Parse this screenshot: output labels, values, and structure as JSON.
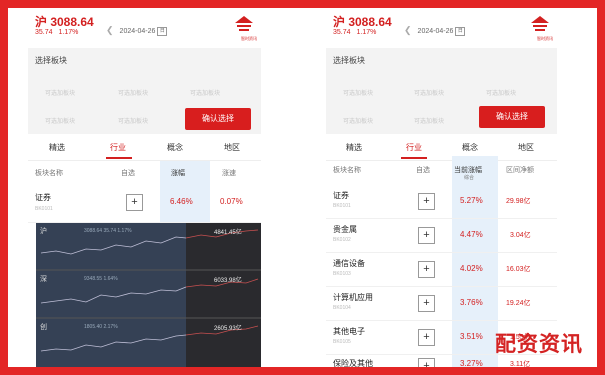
{
  "header": {
    "index_label": "沪 3088.64",
    "change": "35.74",
    "change_pct": "1.17%",
    "date": "2024-04-26",
    "calendar_glyph": "日",
    "logo_text": "智时资讯"
  },
  "selection": {
    "title": "选择板块",
    "options": [
      "可选加板块",
      "可选加板块",
      "可选加板块",
      "可选加板块",
      "可选加板块"
    ],
    "confirm_label": "确认选择"
  },
  "tabs": [
    "精选",
    "行业",
    "概念",
    "地区"
  ],
  "active_tab_index": 1,
  "left_table": {
    "columns": [
      "板块名称",
      "自选",
      "涨幅",
      "涨速"
    ],
    "rows": [
      {
        "name": "证券",
        "code": "BK0101",
        "pct": "6.46%",
        "speed": "0.07%"
      }
    ]
  },
  "charts": [
    {
      "label": "沪",
      "inner": "3088.64  35.74  1.17%",
      "value": "4841.45亿"
    },
    {
      "label": "深",
      "inner": "9348.55  1.64%",
      "value": "6033.98亿"
    },
    {
      "label": "创",
      "inner": "1805.40  2.17%",
      "value": "2605.93亿"
    }
  ],
  "right_table": {
    "columns": [
      "板块名称",
      "自选",
      "当前涨幅",
      "区间净额"
    ],
    "sort_label": "综合",
    "rows": [
      {
        "name": "证券",
        "code": "BK0101",
        "pct": "5.27%",
        "amount": "29.98亿"
      },
      {
        "name": "贵金属",
        "code": "BK0102",
        "pct": "4.47%",
        "amount": "3.04亿"
      },
      {
        "name": "通信设备",
        "code": "BK0103",
        "pct": "4.02%",
        "amount": "16.03亿"
      },
      {
        "name": "计算机应用",
        "code": "BK0104",
        "pct": "3.76%",
        "amount": "19.24亿"
      },
      {
        "name": "其他电子",
        "code": "BK0105",
        "pct": "3.51%",
        "amount": "1.55亿"
      },
      {
        "name": "保险及其他",
        "code": "BK0106",
        "pct": "3.27%",
        "amount": "3.11亿"
      }
    ]
  },
  "watermark": "配资资讯",
  "colors": {
    "accent": "#d32020",
    "panel": "#f3f3f3",
    "highlight": "#e6f0fa",
    "dark": "#2a2a2e"
  }
}
